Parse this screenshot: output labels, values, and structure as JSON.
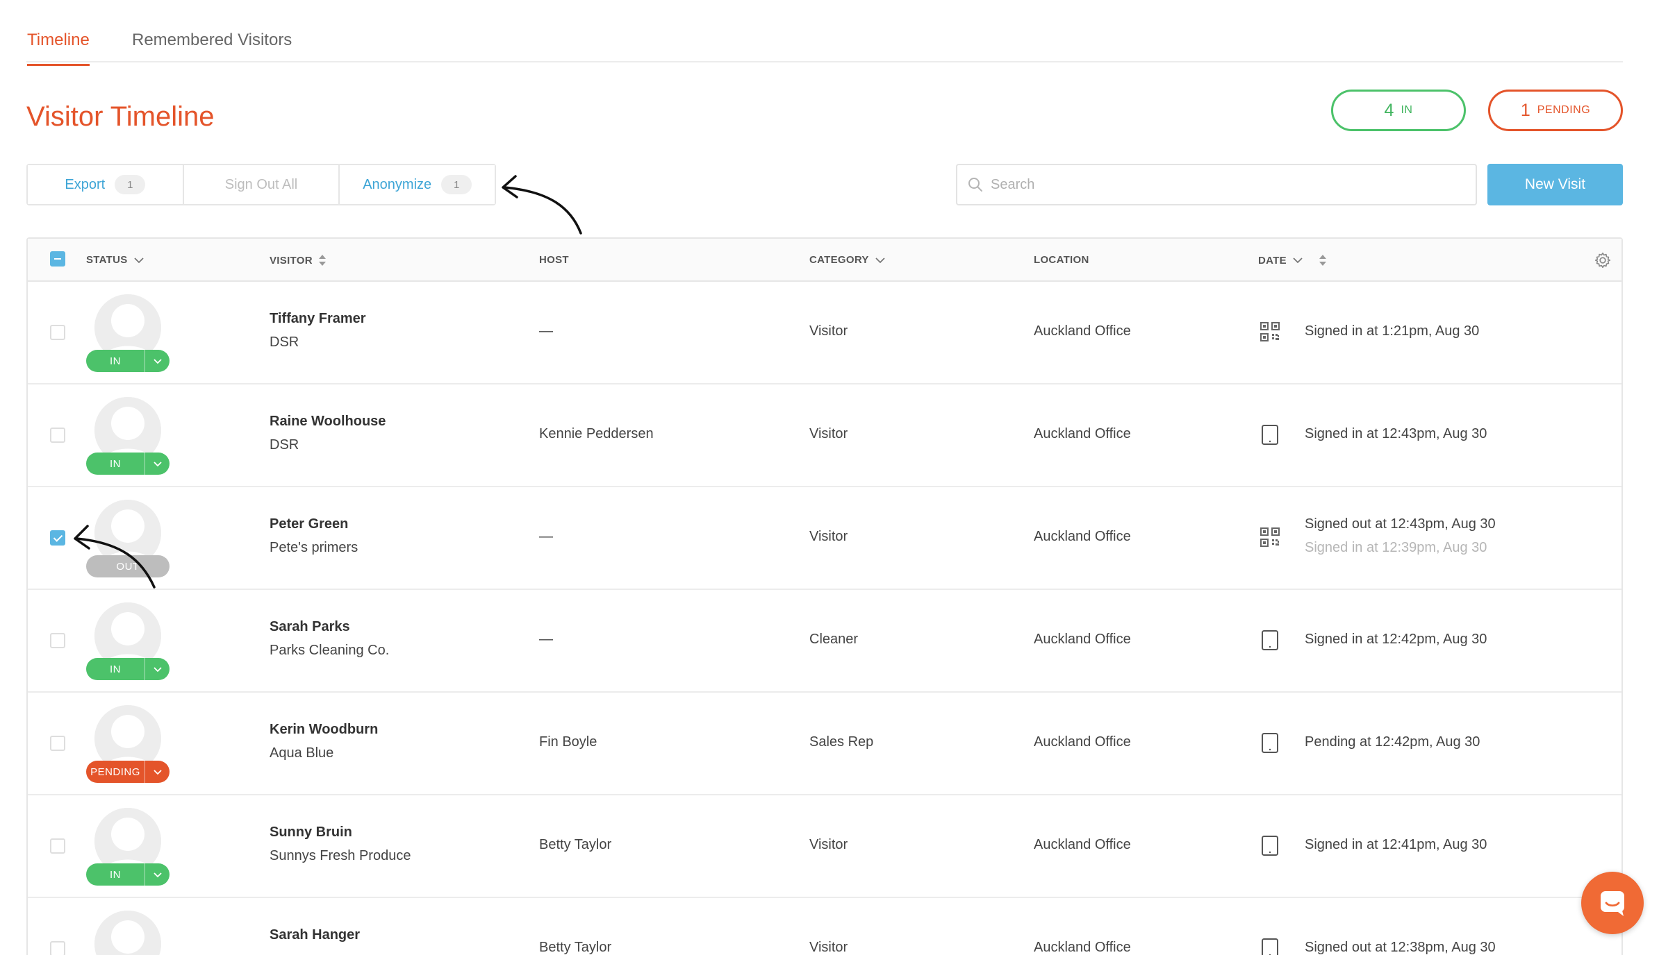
{
  "tabs": [
    {
      "label": "Timeline",
      "active": true
    },
    {
      "label": "Remembered Visitors",
      "active": false
    }
  ],
  "page_title": "Visitor Timeline",
  "counts": {
    "in": {
      "number": "4",
      "label": "IN"
    },
    "pending": {
      "number": "1",
      "label": "PENDING"
    }
  },
  "actions": {
    "export": {
      "label": "Export",
      "badge": "1"
    },
    "sign_out_all": {
      "label": "Sign Out All"
    },
    "anonymize": {
      "label": "Anonymize",
      "badge": "1"
    }
  },
  "search": {
    "placeholder": "Search",
    "value": ""
  },
  "new_visit_label": "New Visit",
  "columns": {
    "status": "STATUS",
    "visitor": "VISITOR",
    "host": "HOST",
    "category": "CATEGORY",
    "location": "LOCATION",
    "date": "DATE"
  },
  "rows": [
    {
      "name": "Tiffany Framer",
      "company": "DSR",
      "host": "—",
      "category": "Visitor",
      "location": "Auckland Office",
      "status": "IN",
      "status_type": "in",
      "checked": false,
      "device": "qr-code-icon",
      "date": "Signed in at 1:21pm, Aug 30",
      "date_sub": ""
    },
    {
      "name": "Raine Woolhouse",
      "company": "DSR",
      "host": "Kennie Peddersen",
      "category": "Visitor",
      "location": "Auckland Office",
      "status": "IN",
      "status_type": "in",
      "checked": false,
      "device": "tablet-icon",
      "date": "Signed in at 12:43pm, Aug 30",
      "date_sub": ""
    },
    {
      "name": "Peter Green",
      "company": "Pete's primers",
      "host": "—",
      "category": "Visitor",
      "location": "Auckland Office",
      "status": "OUT",
      "status_type": "out",
      "checked": true,
      "device": "qr-code-icon",
      "date": "Signed out at 12:43pm, Aug 30",
      "date_sub": "Signed in at 12:39pm, Aug 30"
    },
    {
      "name": "Sarah Parks",
      "company": "Parks Cleaning Co.",
      "host": "—",
      "category": "Cleaner",
      "location": "Auckland Office",
      "status": "IN",
      "status_type": "in",
      "checked": false,
      "device": "tablet-icon",
      "date": "Signed in at 12:42pm, Aug 30",
      "date_sub": ""
    },
    {
      "name": "Kerin Woodburn",
      "company": "Aqua Blue",
      "host": "Fin Boyle",
      "category": "Sales Rep",
      "location": "Auckland Office",
      "status": "PENDING",
      "status_type": "pending",
      "checked": false,
      "device": "tablet-icon",
      "date": "Pending at 12:42pm, Aug 30",
      "date_sub": ""
    },
    {
      "name": "Sunny Bruin",
      "company": "Sunnys Fresh Produce",
      "host": "Betty Taylor",
      "category": "Visitor",
      "location": "Auckland Office",
      "status": "IN",
      "status_type": "in",
      "checked": false,
      "device": "tablet-icon",
      "date": "Signed in at 12:41pm, Aug 30",
      "date_sub": ""
    },
    {
      "name": "Sarah Hanger",
      "company": "",
      "host": "Betty Taylor",
      "category": "Visitor",
      "location": "Auckland Office",
      "status": "",
      "status_type": "none",
      "checked": false,
      "device": "tablet-icon",
      "date": "Signed out at 12:38pm, Aug 30",
      "date_sub": ""
    }
  ],
  "colors": {
    "accent": "#e4542a",
    "in_green": "#4cc26a",
    "link_blue": "#3ea5d6",
    "primary_button": "#5bb6e2",
    "out_gray": "#bdbdbd",
    "chat_button": "#f06a35"
  },
  "icons": {
    "search": "search-icon",
    "settings": "gear-icon",
    "chat": "chat-icon",
    "sort": "sort-arrows-icon",
    "dropdown": "chevron-down-icon"
  }
}
